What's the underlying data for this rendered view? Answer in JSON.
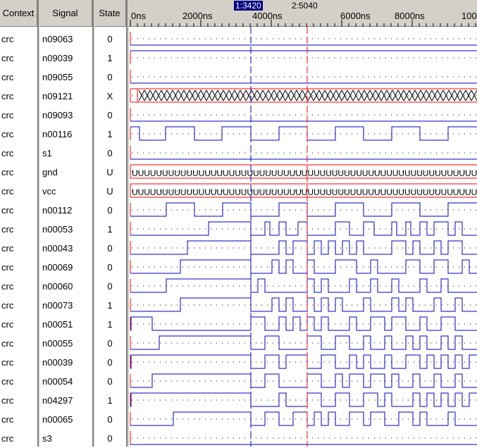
{
  "headers": {
    "context": "Context",
    "signal": "Signal",
    "state": "State"
  },
  "ruler": {
    "ticks": [
      "0ns",
      "2000ns",
      "4000ns",
      "6000ns",
      "8000ns",
      "100"
    ],
    "cursor1_label": "1:3420",
    "cursor2_label": "2:5040"
  },
  "colors": {
    "wave": "#0000c0",
    "cursor1": "#0000c0",
    "cursor2": "#ff0000",
    "bus": "#ff0000",
    "dots": "#000000"
  },
  "rows": [
    {
      "context": "crc",
      "signal": "n09063",
      "state": "0"
    },
    {
      "context": "crc",
      "signal": "n09039",
      "state": "1"
    },
    {
      "context": "crc",
      "signal": "n09055",
      "state": "0"
    },
    {
      "context": "crc",
      "signal": "n09121",
      "state": "X"
    },
    {
      "context": "crc",
      "signal": "n09093",
      "state": "0"
    },
    {
      "context": "crc",
      "signal": "n00116",
      "state": "1"
    },
    {
      "context": "crc",
      "signal": "s1",
      "state": "0"
    },
    {
      "context": "crc",
      "signal": "gnd",
      "state": "U"
    },
    {
      "context": "crc",
      "signal": "vcc",
      "state": "U"
    },
    {
      "context": "crc",
      "signal": "n00112",
      "state": "0"
    },
    {
      "context": "crc",
      "signal": "n00053",
      "state": "1"
    },
    {
      "context": "crc",
      "signal": "n00043",
      "state": "0"
    },
    {
      "context": "crc",
      "signal": "n00069",
      "state": "0"
    },
    {
      "context": "crc",
      "signal": "n00060",
      "state": "0"
    },
    {
      "context": "crc",
      "signal": "n00073",
      "state": "1"
    },
    {
      "context": "crc",
      "signal": "n00051",
      "state": "1"
    },
    {
      "context": "crc",
      "signal": "n00055",
      "state": "0"
    },
    {
      "context": "crc",
      "signal": "n00039",
      "state": "0"
    },
    {
      "context": "crc",
      "signal": "n00054",
      "state": "0"
    },
    {
      "context": "crc",
      "signal": "n04297",
      "state": "1"
    },
    {
      "context": "crc",
      "signal": "n00065",
      "state": "0"
    },
    {
      "context": "crc",
      "signal": "s3",
      "state": "0"
    }
  ]
}
